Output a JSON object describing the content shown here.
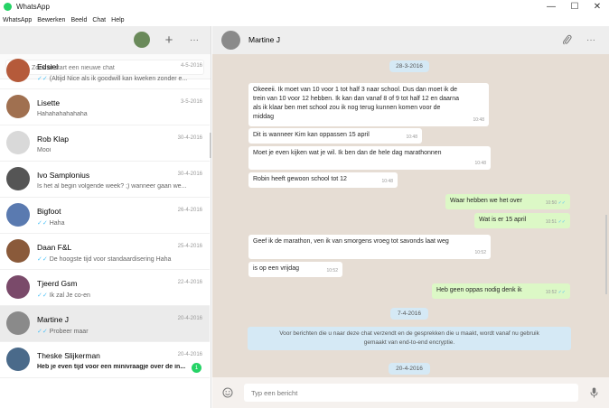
{
  "window": {
    "title": "WhatsApp",
    "minimize": "—",
    "maximize": "☐",
    "close": "✕"
  },
  "menu": [
    "WhatsApp",
    "Bewerken",
    "Beeld",
    "Chat",
    "Help"
  ],
  "sidebar": {
    "search_placeholder": "Zoek of start een nieuwe chat",
    "chats": [
      {
        "name": "Edsiel",
        "date": "4-5-2016",
        "preview": "(Altijd Nice als ik goodwill kan kweken zonder e...",
        "ticks": true,
        "avatar_color": "#b55a3a"
      },
      {
        "name": "Lisette",
        "date": "3-5-2016",
        "preview": "Hahahahahahaha",
        "ticks": false,
        "avatar_color": "#a07050"
      },
      {
        "name": "Rob Klap",
        "date": "30-4-2016",
        "preview": "Mooi",
        "ticks": false,
        "avatar_color": "#d9d9d9"
      },
      {
        "name": "Ivo Samplonius",
        "date": "30-4-2016",
        "preview": "Is het al begin volgende week? ;) wanneer gaan we...",
        "ticks": false,
        "avatar_color": "#555555"
      },
      {
        "name": "Bigfoot",
        "date": "26-4-2016",
        "preview": "Haha",
        "ticks": true,
        "avatar_color": "#5a7ab0"
      },
      {
        "name": "Daan F&L",
        "date": "25-4-2016",
        "preview": "De hoogste tijd voor standaardisering Haha",
        "ticks": true,
        "avatar_color": "#8a5a3a"
      },
      {
        "name": "Tjeerd Gsm",
        "date": "22-4-2016",
        "preview": "Ik zal Je co-en",
        "ticks": true,
        "avatar_color": "#7a4a6a"
      },
      {
        "name": "Martine J",
        "date": "20-4-2016",
        "preview": "Probeer maar",
        "ticks": true,
        "avatar_color": "#8a8a8a",
        "active": true
      },
      {
        "name": "Theske Slijkerman",
        "date": "20-4-2016",
        "preview": "Heb je even tijd voor een minivraagje over de in...",
        "ticks": false,
        "avatar_color": "#4a6a8a",
        "unread": "1"
      }
    ]
  },
  "conversation": {
    "contact": "Martine J",
    "date_chips": [
      "28-3-2016",
      "7-4-2016",
      "20-4-2016"
    ],
    "messages": [
      {
        "dir": "in",
        "lines": [
          "Okeeeii. Ik moet van 10  voor 1 tot half 3 naar school. Dus dan moet ik de",
          "trein van 10 voor 12 hebben. Ik kan dan vanaf 8 of 9 tot half 12 en daarna",
          "als ik klaar ben met school zou ik nog terug kunnen komen voor de",
          "middag"
        ],
        "time": "10:48"
      },
      {
        "dir": "in",
        "lines": [
          "Dit is wanneer Kim kan oppassen 15 april"
        ],
        "time": "10:48"
      },
      {
        "dir": "in",
        "lines": [
          "Moet je even kijken wat je wil. Ik ben dan de hele dag marathonnen"
        ],
        "time": "10:48"
      },
      {
        "dir": "in",
        "lines": [
          "Robin heeft gewoon school tot 12"
        ],
        "time": "10:48"
      },
      {
        "dir": "out",
        "lines": [
          "Waar hebben we het over"
        ],
        "time": "10:50"
      },
      {
        "dir": "out",
        "lines": [
          "Wat is er 15 april"
        ],
        "time": "10:51"
      },
      {
        "dir": "in",
        "lines": [
          "Geef ik de marathon, ven ik van smorgens vroeg tot savonds laat weg"
        ],
        "time": "10:52"
      },
      {
        "dir": "in",
        "lines": [
          "is op een vrijdag"
        ],
        "time": "10:52"
      },
      {
        "dir": "out",
        "lines": [
          "Heb geen oppas nodig denk ik"
        ],
        "time": "10:52"
      }
    ],
    "encryption_notice": [
      "Voor berichten die u naar deze chat verzendt en de gesprekken die u maakt, wordt vanaf nu gebruik",
      "gemaakt van end-to-end encryptie."
    ],
    "composer_placeholder": "Typ een bericht"
  },
  "colors": {
    "accent": "#25d366",
    "out_bubble": "#dcf8c6",
    "in_bubble": "#ffffff",
    "chat_bg": "#e6ddd4",
    "tick": "#4fc3f7"
  }
}
